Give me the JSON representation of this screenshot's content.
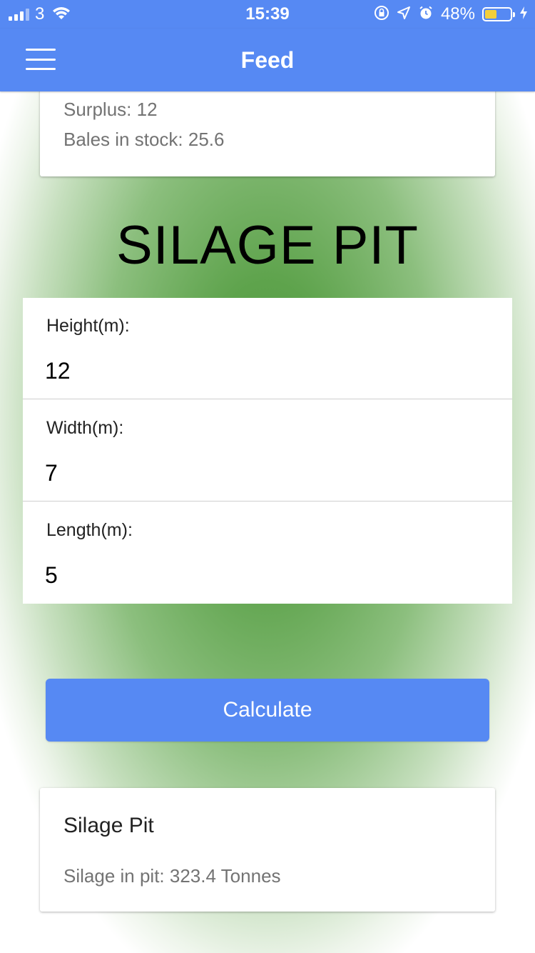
{
  "status_bar": {
    "carrier": "3",
    "time": "15:39",
    "battery_percent": "48%",
    "battery_level": 0.48,
    "icons": [
      "signal-icon",
      "wifi-icon",
      "orientation-lock-icon",
      "location-icon",
      "alarm-icon",
      "battery-icon",
      "charging-icon"
    ]
  },
  "header": {
    "title": "Feed",
    "menu_icon": "hamburger-menu-icon"
  },
  "summary_card": {
    "surplus": "Surplus: 12",
    "bales": "Bales in stock: 25.6"
  },
  "section": {
    "title": "SILAGE PIT"
  },
  "form": {
    "height_label": "Height(m):",
    "height_value": "12",
    "width_label": "Width(m):",
    "width_value": "7",
    "length_label": "Length(m):",
    "length_value": "5"
  },
  "actions": {
    "calculate_label": "Calculate"
  },
  "result_card": {
    "title": "Silage Pit",
    "text": "Silage in pit: 323.4 Tonnes"
  },
  "colors": {
    "primary": "#5689f3",
    "background_green": "#5a9f48",
    "battery_fill": "#f4cf3b"
  }
}
